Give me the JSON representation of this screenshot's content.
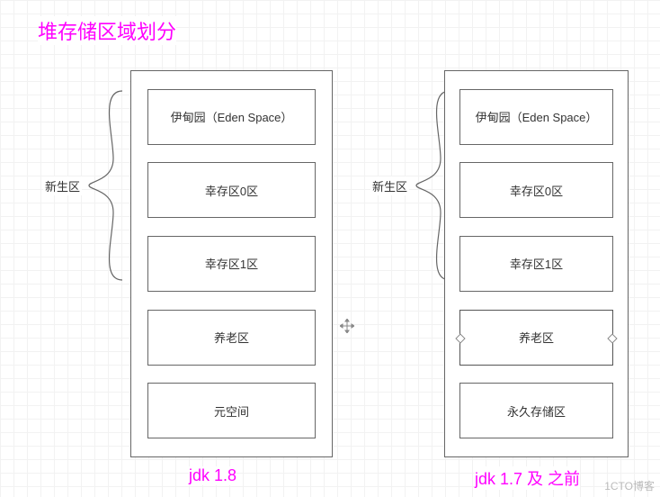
{
  "title": "堆存储区域划分",
  "brace_label": "新生区",
  "left": {
    "caption": "jdk 1.8",
    "cells": [
      "伊甸园（Eden Space）",
      "幸存区0区",
      "幸存区1区",
      "养老区",
      "元空间"
    ]
  },
  "right": {
    "caption": "jdk 1.7 及 之前",
    "cells": [
      "伊甸园（Eden Space）",
      "幸存区0区",
      "幸存区1区",
      "养老区",
      "永久存储区"
    ],
    "selected_index": 3
  },
  "watermark": "1CTO博客"
}
